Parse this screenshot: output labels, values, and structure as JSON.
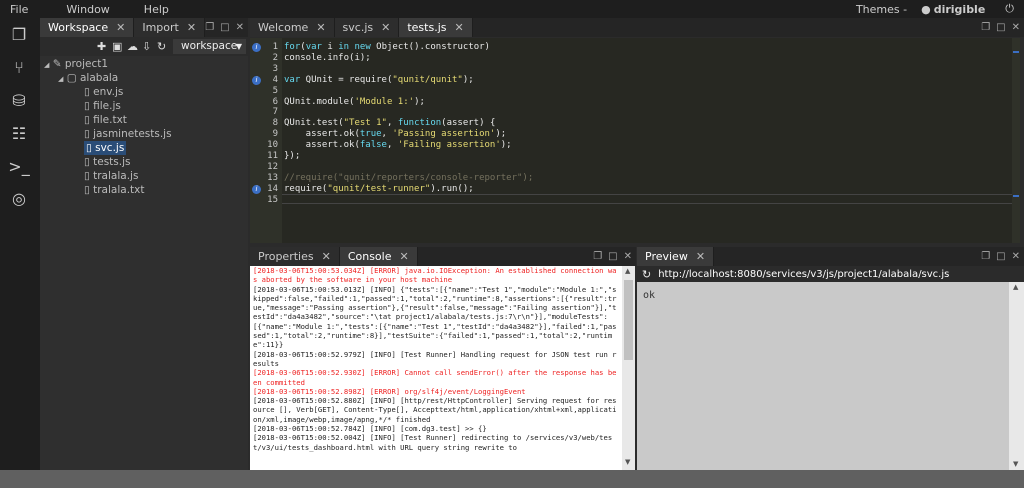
{
  "menu": {
    "file": "File",
    "window": "Window",
    "help": "Help",
    "themes": "Themes -",
    "user": "dirigible"
  },
  "workspace": {
    "tabs": [
      {
        "label": "Workspace"
      },
      {
        "label": "Import"
      }
    ],
    "selector": "workspace",
    "tree": {
      "project": "project1",
      "folder": "alabala",
      "files": [
        "env.js",
        "file.js",
        "file.txt",
        "jasminetests.js",
        "svc.js",
        "tests.js",
        "tralala.js",
        "tralala.txt"
      ],
      "selected": "svc.js"
    }
  },
  "editor": {
    "tabs": [
      {
        "label": "Welcome"
      },
      {
        "label": "svc.js"
      },
      {
        "label": "tests.js"
      }
    ],
    "active_tab": "tests.js",
    "line_numbers": [
      "1",
      "2",
      "3",
      "4",
      "5",
      "6",
      "7",
      "8",
      "9",
      "10",
      "11",
      "12",
      "13",
      "14",
      "15"
    ],
    "lines": [
      "for(var i in new Object().constructor)",
      "console.info(i);",
      "",
      "var QUnit = require(\"qunit/qunit\");",
      "",
      "QUnit.module('Module 1:');",
      "",
      "QUnit.test(\"Test 1\", function(assert) {",
      "    assert.ok(true, 'Passing assertion');",
      "    assert.ok(false, 'Failing assertion');",
      "});",
      "",
      "//require(\"qunit/reporters/console-reporter\");",
      "require(\"qunit/test-runner\").run();",
      ""
    ]
  },
  "bottom": {
    "tabs": [
      {
        "label": "Properties"
      },
      {
        "label": "Console"
      }
    ],
    "active_tab": "Console",
    "console_lines": [
      {
        "text": "[2018-03-06T15:00:53.034Z] [ERROR] java.io.IOException: An established connection was aborted by the software in your host machine",
        "err": true
      },
      {
        "text": "[2018-03-06T15:00:53.013Z] [INFO] {\"tests\":[{\"name\":\"Test 1\",\"module\":\"Module 1:\",\"skipped\":false,\"failed\":1,\"passed\":1,\"total\":2,\"runtime\":8,\"assertions\":[{\"result\":true,\"message\":\"Passing assertion\"},{\"result\":false,\"message\":\"Failing assertion\"}],\"testId\":\"da4a3482\",\"source\":\"\\tat project1/alabala/tests.js:7\\r\\n\"}],\"moduleTests\":[{\"name\":\"Module 1:\",\"tests\":[{\"name\":\"Test 1\",\"testId\":\"da4a3482\"}],\"failed\":1,\"passed\":1,\"total\":2,\"runtime\":8}],\"testSuite\":{\"failed\":1,\"passed\":1,\"total\":2,\"runtime\":11}}",
        "err": false
      },
      {
        "text": "[2018-03-06T15:00:52.979Z] [INFO] [Test Runner] Handling request for JSON test run results",
        "err": false
      },
      {
        "text": "[2018-03-06T15:00:52.930Z] [ERROR] Cannot call sendError() after the response has been committed",
        "err": true
      },
      {
        "text": "[2018-03-06T15:00:52.898Z] [ERROR] org/slf4j/event/LoggingEvent",
        "err": true
      },
      {
        "text": "[2018-03-06T15:00:52.880Z] [INFO] [http/rest/HttpController] Serving request for resource [], Verb[GET], Content-Type[], Accepttext/html,application/xhtml+xml,application/xml,image/webp,image/apng,*/* finished",
        "err": false
      },
      {
        "text": "[2018-03-06T15:00:52.784Z] [INFO] [com.dg3.test] >> {}",
        "err": false
      },
      {
        "text": "[2018-03-06T15:00:52.004Z] [INFO] [Test Runner] redirecting to /services/v3/web/test/v3/ui/tests_dashboard.html with URL query string rewrite to",
        "err": false
      }
    ]
  },
  "preview": {
    "tab": "Preview",
    "url": "http://localhost:8080/services/v3/js/project1/alabala/svc.js",
    "content": "ok"
  }
}
